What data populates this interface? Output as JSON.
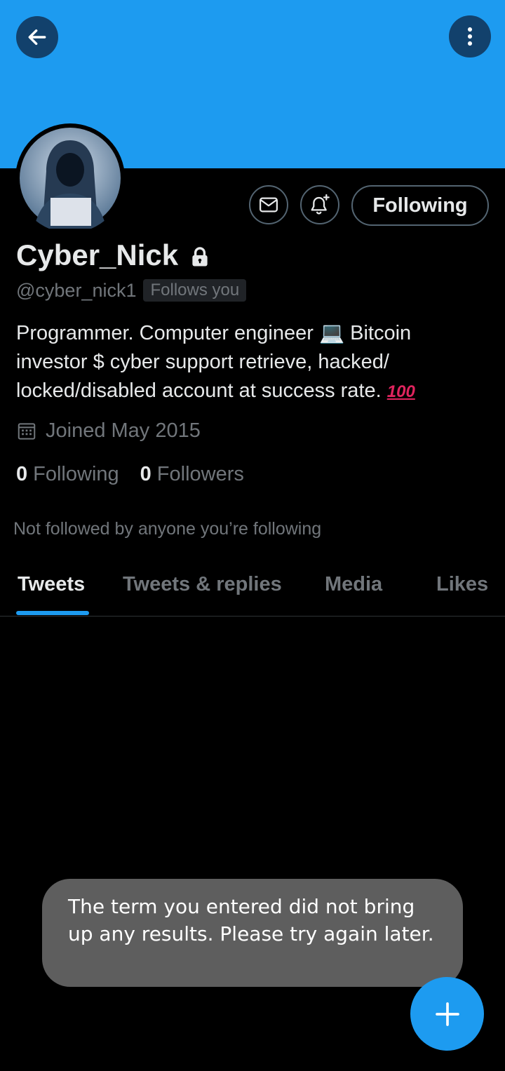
{
  "profile": {
    "display_name": "Cyber_Nick",
    "handle": "@cyber_nick1",
    "follows_you_badge": "Follows you",
    "bio": "Programmer. Computer engineer 💻 Bitcoin investor $ cyber support retrieve, hacked/ locked/disabled account at success rate.",
    "bio_emoji": "100",
    "joined": "Joined May 2015",
    "following_count": "0",
    "following_label": "Following",
    "followers_count": "0",
    "followers_label": "Followers",
    "not_followed_text": "Not followed by anyone you’re following"
  },
  "actions": {
    "following_button": "Following"
  },
  "tabs": [
    {
      "label": "Tweets",
      "active": true
    },
    {
      "label": "Tweets & replies",
      "active": false
    },
    {
      "label": "Media",
      "active": false
    },
    {
      "label": "Likes",
      "active": false
    }
  ],
  "toast": {
    "message": "The term you entered did not bring up any results. Please try again later."
  },
  "icons": {
    "back": "back-arrow-icon",
    "more": "more-vertical-icon",
    "message": "envelope-icon",
    "notify": "bell-plus-icon",
    "lock": "lock-icon",
    "calendar": "calendar-icon",
    "compose": "plus-icon"
  },
  "colors": {
    "accent": "#1d9bf0",
    "background": "#000000",
    "secondary_text": "#71767b"
  }
}
